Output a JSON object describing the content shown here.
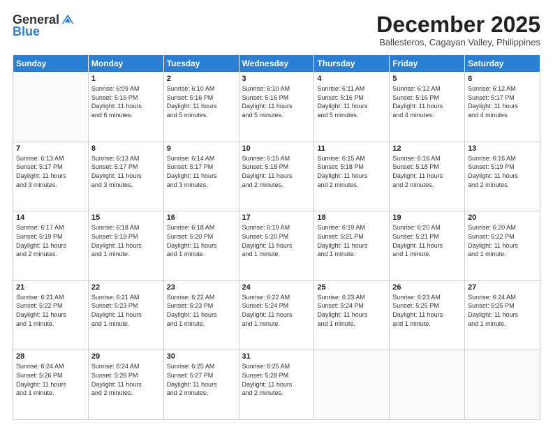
{
  "header": {
    "logo_general": "General",
    "logo_blue": "Blue",
    "month_title": "December 2025",
    "location": "Ballesteros, Cagayan Valley, Philippines"
  },
  "weekdays": [
    "Sunday",
    "Monday",
    "Tuesday",
    "Wednesday",
    "Thursday",
    "Friday",
    "Saturday"
  ],
  "weeks": [
    [
      {
        "day": "",
        "info": ""
      },
      {
        "day": "1",
        "info": "Sunrise: 6:09 AM\nSunset: 5:16 PM\nDaylight: 11 hours\nand 6 minutes."
      },
      {
        "day": "2",
        "info": "Sunrise: 6:10 AM\nSunset: 5:16 PM\nDaylight: 11 hours\nand 5 minutes."
      },
      {
        "day": "3",
        "info": "Sunrise: 6:10 AM\nSunset: 5:16 PM\nDaylight: 11 hours\nand 5 minutes."
      },
      {
        "day": "4",
        "info": "Sunrise: 6:11 AM\nSunset: 5:16 PM\nDaylight: 11 hours\nand 5 minutes."
      },
      {
        "day": "5",
        "info": "Sunrise: 6:12 AM\nSunset: 5:16 PM\nDaylight: 11 hours\nand 4 minutes."
      },
      {
        "day": "6",
        "info": "Sunrise: 6:12 AM\nSunset: 5:17 PM\nDaylight: 11 hours\nand 4 minutes."
      }
    ],
    [
      {
        "day": "7",
        "info": "Sunrise: 6:13 AM\nSunset: 5:17 PM\nDaylight: 11 hours\nand 3 minutes."
      },
      {
        "day": "8",
        "info": "Sunrise: 6:13 AM\nSunset: 5:17 PM\nDaylight: 11 hours\nand 3 minutes."
      },
      {
        "day": "9",
        "info": "Sunrise: 6:14 AM\nSunset: 5:17 PM\nDaylight: 11 hours\nand 3 minutes."
      },
      {
        "day": "10",
        "info": "Sunrise: 6:15 AM\nSunset: 5:18 PM\nDaylight: 11 hours\nand 2 minutes."
      },
      {
        "day": "11",
        "info": "Sunrise: 6:15 AM\nSunset: 5:18 PM\nDaylight: 11 hours\nand 2 minutes."
      },
      {
        "day": "12",
        "info": "Sunrise: 6:16 AM\nSunset: 5:18 PM\nDaylight: 11 hours\nand 2 minutes."
      },
      {
        "day": "13",
        "info": "Sunrise: 6:16 AM\nSunset: 5:19 PM\nDaylight: 11 hours\nand 2 minutes."
      }
    ],
    [
      {
        "day": "14",
        "info": "Sunrise: 6:17 AM\nSunset: 5:19 PM\nDaylight: 11 hours\nand 2 minutes."
      },
      {
        "day": "15",
        "info": "Sunrise: 6:18 AM\nSunset: 5:19 PM\nDaylight: 11 hours\nand 1 minute."
      },
      {
        "day": "16",
        "info": "Sunrise: 6:18 AM\nSunset: 5:20 PM\nDaylight: 11 hours\nand 1 minute."
      },
      {
        "day": "17",
        "info": "Sunrise: 6:19 AM\nSunset: 5:20 PM\nDaylight: 11 hours\nand 1 minute."
      },
      {
        "day": "18",
        "info": "Sunrise: 6:19 AM\nSunset: 5:21 PM\nDaylight: 11 hours\nand 1 minute."
      },
      {
        "day": "19",
        "info": "Sunrise: 6:20 AM\nSunset: 5:21 PM\nDaylight: 11 hours\nand 1 minute."
      },
      {
        "day": "20",
        "info": "Sunrise: 6:20 AM\nSunset: 5:22 PM\nDaylight: 11 hours\nand 1 minute."
      }
    ],
    [
      {
        "day": "21",
        "info": "Sunrise: 6:21 AM\nSunset: 5:22 PM\nDaylight: 11 hours\nand 1 minute."
      },
      {
        "day": "22",
        "info": "Sunrise: 6:21 AM\nSunset: 5:23 PM\nDaylight: 11 hours\nand 1 minute."
      },
      {
        "day": "23",
        "info": "Sunrise: 6:22 AM\nSunset: 5:23 PM\nDaylight: 11 hours\nand 1 minute."
      },
      {
        "day": "24",
        "info": "Sunrise: 6:22 AM\nSunset: 5:24 PM\nDaylight: 11 hours\nand 1 minute."
      },
      {
        "day": "25",
        "info": "Sunrise: 6:23 AM\nSunset: 5:24 PM\nDaylight: 11 hours\nand 1 minute."
      },
      {
        "day": "26",
        "info": "Sunrise: 6:23 AM\nSunset: 5:25 PM\nDaylight: 11 hours\nand 1 minute."
      },
      {
        "day": "27",
        "info": "Sunrise: 6:24 AM\nSunset: 5:25 PM\nDaylight: 11 hours\nand 1 minute."
      }
    ],
    [
      {
        "day": "28",
        "info": "Sunrise: 6:24 AM\nSunset: 5:26 PM\nDaylight: 11 hours\nand 1 minute."
      },
      {
        "day": "29",
        "info": "Sunrise: 6:24 AM\nSunset: 5:26 PM\nDaylight: 11 hours\nand 2 minutes."
      },
      {
        "day": "30",
        "info": "Sunrise: 6:25 AM\nSunset: 5:27 PM\nDaylight: 11 hours\nand 2 minutes."
      },
      {
        "day": "31",
        "info": "Sunrise: 6:25 AM\nSunset: 5:28 PM\nDaylight: 11 hours\nand 2 minutes."
      },
      {
        "day": "",
        "info": ""
      },
      {
        "day": "",
        "info": ""
      },
      {
        "day": "",
        "info": ""
      }
    ]
  ]
}
